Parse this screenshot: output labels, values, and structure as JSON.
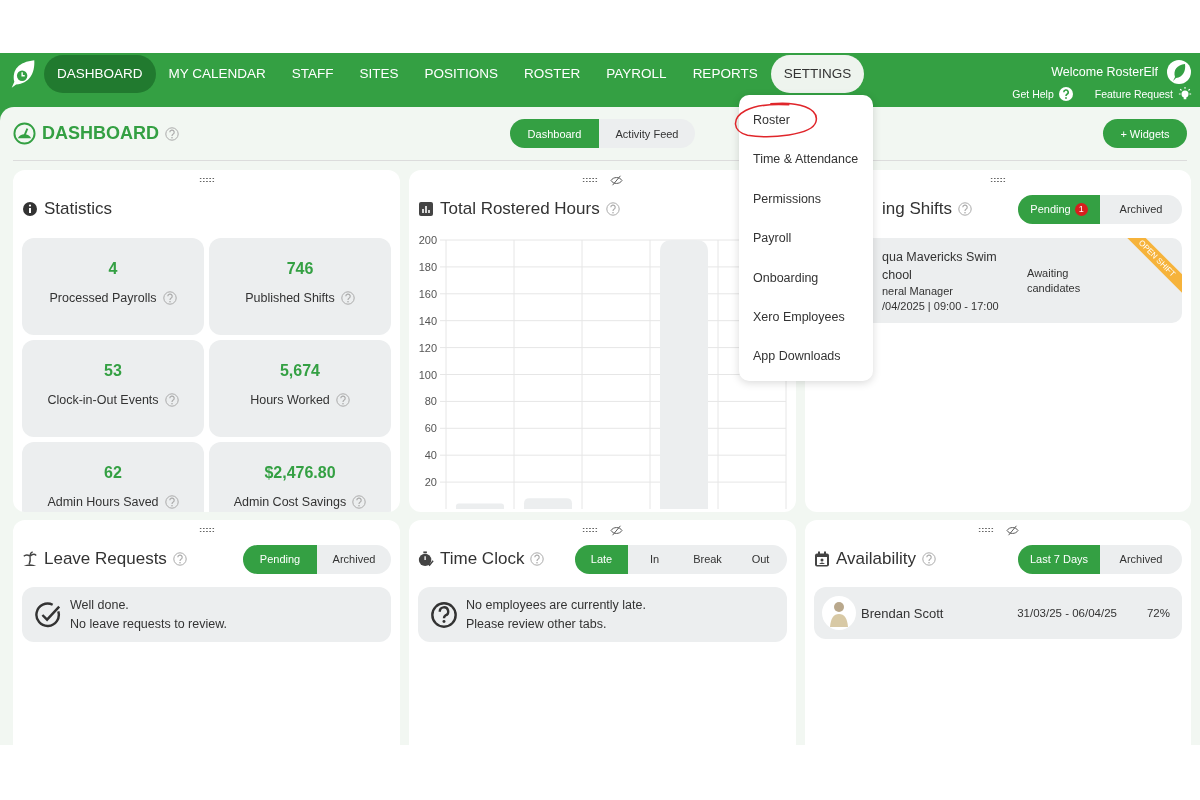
{
  "nav": {
    "items": [
      {
        "label": "DASHBOARD",
        "selected": true,
        "expanded": false
      },
      {
        "label": "MY CALENDAR",
        "selected": false,
        "expanded": false
      },
      {
        "label": "STAFF",
        "selected": false,
        "expanded": false
      },
      {
        "label": "SITES",
        "selected": false,
        "expanded": false
      },
      {
        "label": "POSITIONS",
        "selected": false,
        "expanded": false
      },
      {
        "label": "ROSTER",
        "selected": false,
        "expanded": false
      },
      {
        "label": "PAYROLL",
        "selected": false,
        "expanded": false
      },
      {
        "label": "REPORTS",
        "selected": false,
        "expanded": false
      },
      {
        "label": "SETTINGS",
        "selected": false,
        "expanded": true
      }
    ],
    "welcome": "Welcome RosterElf",
    "links": [
      {
        "label": "Get Help",
        "kind": "help"
      },
      {
        "label": "Feature Request",
        "kind": "idea"
      }
    ]
  },
  "settings_menu": {
    "items": [
      {
        "label": "Roster",
        "circled": true
      },
      {
        "label": "Time & Attendance",
        "circled": false
      },
      {
        "label": "Permissions",
        "circled": false
      },
      {
        "label": "Payroll",
        "circled": false
      },
      {
        "label": "Onboarding",
        "circled": false
      },
      {
        "label": "Xero Employees",
        "circled": false
      },
      {
        "label": "App Downloads",
        "circled": false
      }
    ]
  },
  "page_header": {
    "title": "DASHBOARD",
    "views": [
      {
        "label": "Dashboard",
        "selected": true
      },
      {
        "label": "Activity Feed",
        "selected": false
      }
    ],
    "action": "+ Widgets"
  },
  "statistics": {
    "title": "Statistics",
    "hideable": false,
    "tiles": [
      {
        "value": "4",
        "label": "Processed Payrolls"
      },
      {
        "value": "746",
        "label": "Published Shifts"
      },
      {
        "value": "53",
        "label": "Clock-in-Out Events"
      },
      {
        "value": "5,674",
        "label": "Hours Worked"
      },
      {
        "value": "62",
        "label": "Admin Hours Saved"
      },
      {
        "value": "$2,476.80",
        "label": "Admin Cost Savings"
      }
    ]
  },
  "rostered_hours": {
    "title": "Total Rostered Hours",
    "hideable": true,
    "chart_data": {
      "type": "bar",
      "values": [
        4,
        8,
        0,
        200,
        null
      ],
      "grid": true,
      "ylim": [
        0,
        200
      ],
      "yticks": [
        20,
        40,
        60,
        80,
        100,
        120,
        140,
        160,
        180,
        200
      ]
    }
  },
  "shifts": {
    "title": "ing Shifts",
    "hideable": false,
    "tabs": [
      {
        "label": "Pending",
        "badge": "1",
        "selected": true
      },
      {
        "label": "Archived",
        "selected": false
      }
    ],
    "items": [
      {
        "lines": [
          "qua Mavericks Swim",
          "chool"
        ],
        "role": "neral Manager",
        "time": "/04/2025 | 09:00 - 17:00",
        "status": "Awaiting candidates",
        "ribbon": "OPEN SHIFT"
      }
    ]
  },
  "leave": {
    "title": "Leave Requests",
    "hideable": false,
    "tabs": [
      {
        "label": "Pending",
        "selected": true
      },
      {
        "label": "Archived",
        "selected": false
      }
    ],
    "message": {
      "kind": "done",
      "lines": [
        "Well done.",
        "No leave requests to review."
      ]
    }
  },
  "time_clock": {
    "title": "Time Clock",
    "hideable": true,
    "tabs": [
      {
        "label": "Late",
        "selected": true
      },
      {
        "label": "In",
        "selected": false
      },
      {
        "label": "Break",
        "selected": false
      },
      {
        "label": "Out",
        "selected": false
      }
    ],
    "message": {
      "kind": "question",
      "lines": [
        "No employees are currently late.",
        "Please review other tabs."
      ]
    }
  },
  "availability": {
    "title": "Availability",
    "hideable": true,
    "tabs": [
      {
        "label": "Last 7 Days",
        "selected": true
      },
      {
        "label": "Archived",
        "selected": false
      }
    ],
    "rows": [
      {
        "name": "Brendan Scott",
        "dates": "31/03/25 - 06/04/25",
        "percent": "72%"
      }
    ]
  }
}
